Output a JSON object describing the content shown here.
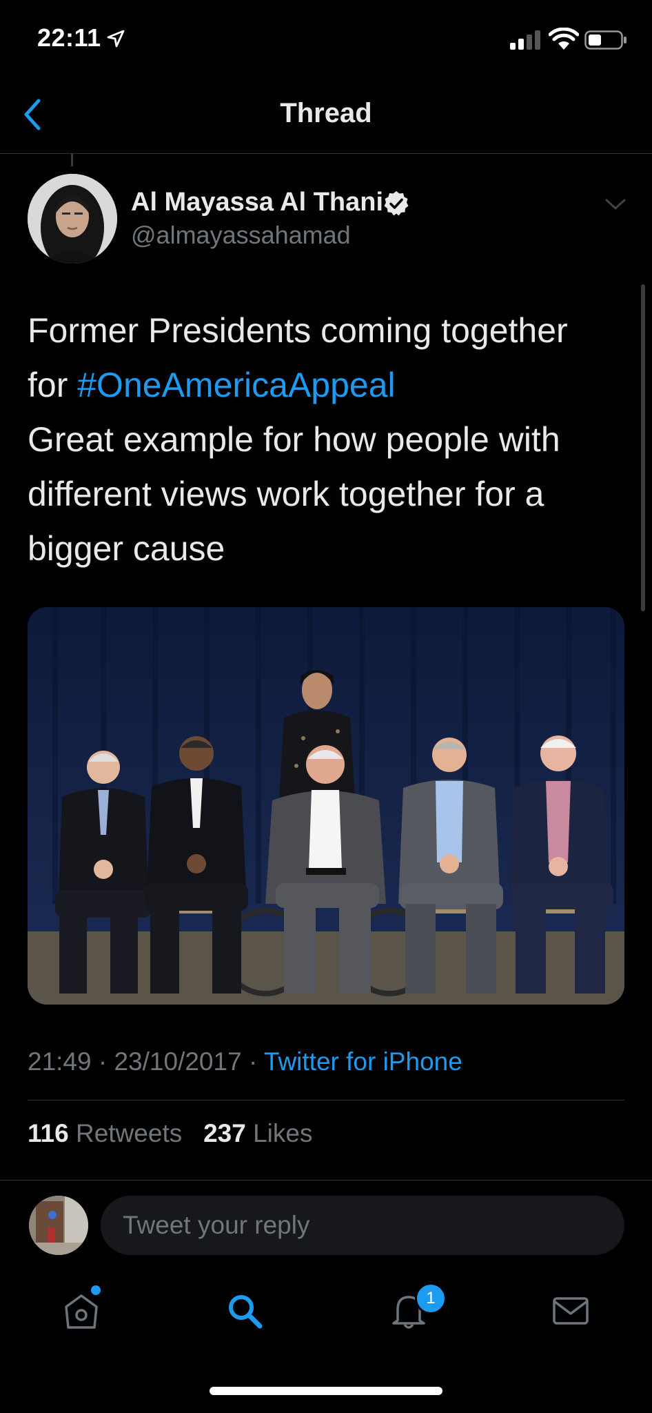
{
  "status_bar": {
    "time": "22:11"
  },
  "nav": {
    "title": "Thread"
  },
  "tweet": {
    "author_name": "Al Mayassa Al Thani",
    "author_handle": "@almayassahamad",
    "text_line1": "Former Presidents coming together",
    "text_line2_prefix": "for ",
    "hashtag": "#OneAmericaAppeal",
    "text_line3": "Great example for how people with",
    "text_line4": "different views work together for a",
    "text_line5": "bigger cause",
    "time": "21:49",
    "date": "23/10/2017",
    "source": "Twitter for iPhone",
    "retweets_count": "116",
    "retweets_label": "Retweets",
    "likes_count": "237",
    "likes_label": "Likes"
  },
  "reply": {
    "placeholder": "Tweet your reply"
  },
  "tab_bar": {
    "notification_badge": "1"
  },
  "colors": {
    "accent": "#1d9bf0",
    "background": "#000000",
    "secondary_text": "#71767b"
  }
}
